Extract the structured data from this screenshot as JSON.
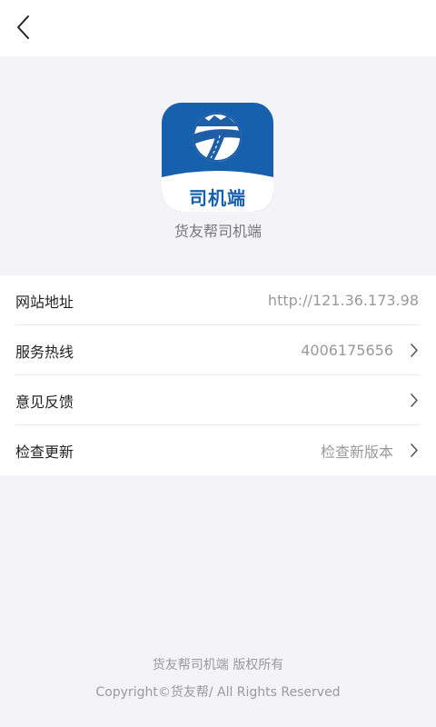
{
  "nav": {
    "back_icon": "chevron-left-icon"
  },
  "app": {
    "logo_text": "司机端",
    "name": "货友帮司机端",
    "brand_color": "#1660ad"
  },
  "settings": {
    "rows": [
      {
        "label": "网站地址",
        "value": "http://121.36.173.98",
        "has_arrow": false
      },
      {
        "label": "服务热线",
        "value": "4006175656",
        "has_arrow": true
      },
      {
        "label": "意见反馈",
        "value": "",
        "has_arrow": true
      },
      {
        "label": "检查更新",
        "value": "检查新版本",
        "has_arrow": true
      }
    ]
  },
  "footer": {
    "rights": "货友帮司机端 版权所有",
    "copyright": "Copyright©货友帮/ All Rights Reserved"
  }
}
